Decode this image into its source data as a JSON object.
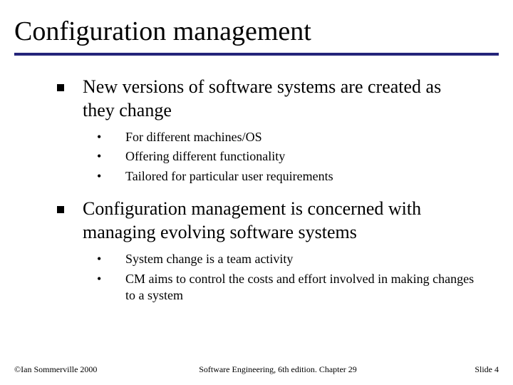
{
  "title": "Configuration management",
  "bullets": [
    {
      "text": "New versions of software systems are created as they change",
      "sub": [
        "For different machines/OS",
        "Offering different functionality",
        "Tailored for particular user requirements"
      ]
    },
    {
      "text": "Configuration management is concerned with managing evolving software systems",
      "sub": [
        "System change is a team activity",
        "CM aims to control the costs and effort involved in making changes to a system"
      ]
    }
  ],
  "footer": {
    "left": "©Ian Sommerville 2000",
    "center": "Software Engineering, 6th edition. Chapter 29",
    "right": "Slide 4"
  }
}
